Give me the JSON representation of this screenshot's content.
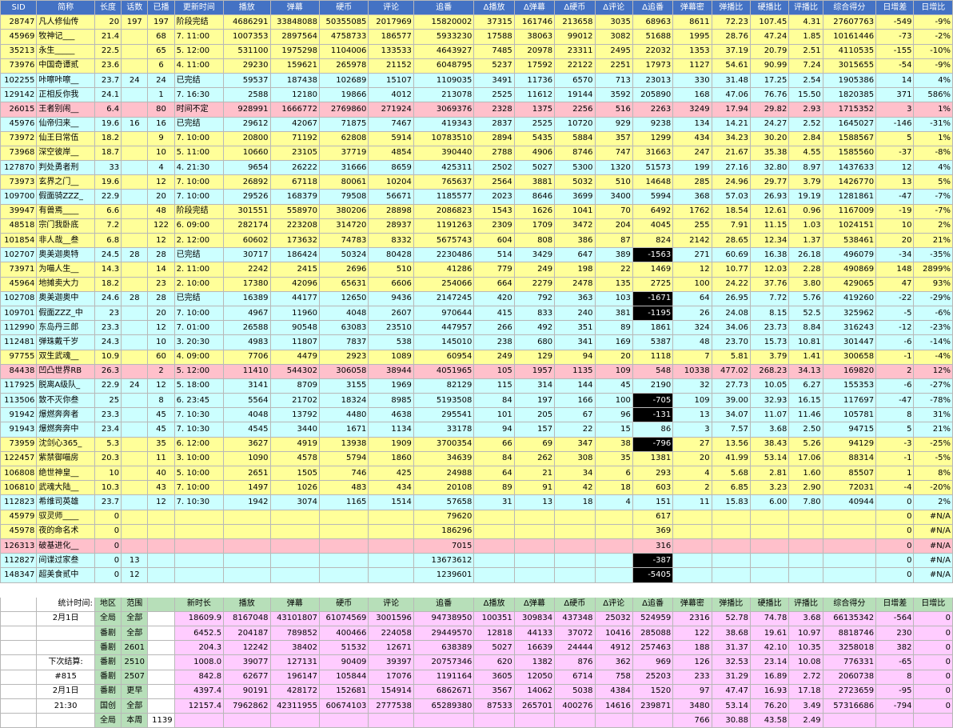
{
  "columns": [
    "SID",
    "简称",
    "长度",
    "话数",
    "已播",
    "更新时间",
    "播放",
    "弹幕",
    "硬币",
    "评论",
    "追番",
    "Δ播放",
    "Δ弹幕",
    "Δ硬币",
    "Δ评论",
    "Δ追番",
    "弹幕密",
    "弹播比",
    "硬播比",
    "评播比",
    "综合得分",
    "日增差",
    "日增比"
  ],
  "rows": [
    {
      "t": "y",
      "v": [
        "28747",
        "凡人修仙传",
        "20",
        "197",
        "197",
        "阶段完结",
        "4686291",
        "33848088",
        "50355085",
        "2017969",
        "15820002",
        "37315",
        "161746",
        "213658",
        "3035",
        "68963",
        "8611",
        "72.23",
        "107.45",
        "4.31",
        "27607763",
        "-549",
        "-9%"
      ]
    },
    {
      "t": "y",
      "v": [
        "45969",
        "牧神记___",
        "21.4",
        "",
        "68",
        "7. 11:00",
        "1007353",
        "2897564",
        "4758733",
        "186577",
        "5933230",
        "17588",
        "38063",
        "99012",
        "3082",
        "51688",
        "1995",
        "28.76",
        "47.24",
        "1.85",
        "10161446",
        "-73",
        "-2%"
      ]
    },
    {
      "t": "y",
      "v": [
        "35213",
        "永生_____",
        "22.5",
        "",
        "65",
        "5. 12:00",
        "531100",
        "1975298",
        "1104006",
        "133533",
        "4643927",
        "7485",
        "20978",
        "23311",
        "2495",
        "22032",
        "1353",
        "37.19",
        "20.79",
        "2.51",
        "4110535",
        "-155",
        "-10%"
      ]
    },
    {
      "t": "y",
      "v": [
        "73976",
        "中国奇谭贰",
        "23.6",
        "",
        "6",
        "4. 11:00",
        "29230",
        "159621",
        "265978",
        "21152",
        "6048795",
        "5237",
        "17592",
        "22122",
        "2251",
        "17973",
        "1127",
        "54.61",
        "90.99",
        "7.24",
        "3015655",
        "-54",
        "-9%"
      ]
    },
    {
      "t": "c",
      "v": [
        "102255",
        "咔嚓咔嚓__",
        "23.7",
        "24",
        "24",
        "已完结",
        "59537",
        "187438",
        "102689",
        "15107",
        "1109035",
        "3491",
        "11736",
        "6570",
        "713",
        "23013",
        "330",
        "31.48",
        "17.25",
        "2.54",
        "1905386",
        "14",
        "4%"
      ]
    },
    {
      "t": "c",
      "v": [
        "129142",
        "正相反你我",
        "24.1",
        "",
        "1",
        "7. 16:30",
        "2588",
        "12180",
        "19866",
        "4012",
        "213078",
        "2525",
        "11612",
        "19144",
        "3592",
        "205890",
        "168",
        "47.06",
        "76.76",
        "15.50",
        "1820385",
        "371",
        "586%"
      ]
    },
    {
      "t": "p",
      "v": [
        "26015",
        "王者别闹__",
        "6.4",
        "",
        "80",
        "时间不定",
        "928991",
        "1666772",
        "2769860",
        "271924",
        "3069376",
        "2328",
        "1375",
        "2256",
        "516",
        "2263",
        "3249",
        "17.94",
        "29.82",
        "2.93",
        "1715352",
        "3",
        "1%"
      ]
    },
    {
      "t": "c",
      "v": [
        "45976",
        "仙帝归来__",
        "19.6",
        "16",
        "16",
        "已完结",
        "29612",
        "42067",
        "71875",
        "7467",
        "419343",
        "2837",
        "2525",
        "10720",
        "929",
        "9238",
        "134",
        "14.21",
        "24.27",
        "2.52",
        "1645027",
        "-146",
        "-31%"
      ]
    },
    {
      "t": "y",
      "v": [
        "73972",
        "仙王日常伍",
        "18.2",
        "",
        "9",
        "7. 10:00",
        "20800",
        "71192",
        "62808",
        "5914",
        "10783510",
        "2894",
        "5435",
        "5884",
        "357",
        "1299",
        "434",
        "34.23",
        "30.20",
        "2.84",
        "1588567",
        "5",
        "1%"
      ]
    },
    {
      "t": "y",
      "v": [
        "73968",
        "深空彼岸__",
        "18.7",
        "",
        "10",
        "5. 11:00",
        "10660",
        "23105",
        "37719",
        "4854",
        "390440",
        "2788",
        "4906",
        "8746",
        "747",
        "31663",
        "247",
        "21.67",
        "35.38",
        "4.55",
        "1585560",
        "-37",
        "-8%"
      ]
    },
    {
      "t": "c",
      "v": [
        "127870",
        "判处勇者刑",
        "33",
        "",
        "4",
        "4. 21:30",
        "9654",
        "26222",
        "31666",
        "8659",
        "425311",
        "2502",
        "5027",
        "5300",
        "1320",
        "51573",
        "199",
        "27.16",
        "32.80",
        "8.97",
        "1437633",
        "12",
        "4%"
      ]
    },
    {
      "t": "y",
      "v": [
        "73973",
        "玄界之门__",
        "19.6",
        "",
        "12",
        "7. 10:00",
        "26892",
        "67118",
        "80061",
        "10204",
        "765637",
        "2564",
        "3881",
        "5032",
        "510",
        "14648",
        "285",
        "24.96",
        "29.77",
        "3.79",
        "1426770",
        "13",
        "5%"
      ]
    },
    {
      "t": "c",
      "v": [
        "109700",
        "假面骑ZZZ_",
        "22.9",
        "",
        "20",
        "7. 10:00",
        "29526",
        "168379",
        "79508",
        "56671",
        "1185577",
        "2023",
        "8646",
        "3699",
        "3400",
        "5994",
        "368",
        "57.03",
        "26.93",
        "19.19",
        "1281861",
        "-47",
        "-7%"
      ]
    },
    {
      "t": "y",
      "v": [
        "39947",
        "有兽焉____",
        "6.6",
        "",
        "48",
        "阶段完结",
        "301551",
        "558970",
        "380206",
        "28898",
        "2086823",
        "1543",
        "1626",
        "1041",
        "70",
        "6492",
        "1762",
        "18.54",
        "12.61",
        "0.96",
        "1167009",
        "-19",
        "-7%"
      ]
    },
    {
      "t": "y",
      "v": [
        "48518",
        "宗门我卧底",
        "7.2",
        "",
        "122",
        "6. 09:00",
        "282174",
        "223208",
        "314720",
        "28937",
        "1191263",
        "2309",
        "1709",
        "3472",
        "204",
        "4045",
        "255",
        "7.91",
        "11.15",
        "1.03",
        "1024151",
        "10",
        "2%"
      ]
    },
    {
      "t": "y",
      "v": [
        "101854",
        "非人哉__叁",
        "6.8",
        "",
        "12",
        "2. 12:00",
        "60602",
        "173632",
        "74783",
        "8332",
        "5675743",
        "604",
        "808",
        "386",
        "87",
        "824",
        "2142",
        "28.65",
        "12.34",
        "1.37",
        "538461",
        "20",
        "21%"
      ]
    },
    {
      "t": "c",
      "v": [
        "102707",
        "奥美迦奥特",
        "24.5",
        "28",
        "28",
        "已完结",
        "30717",
        "186424",
        "50324",
        "80428",
        "2230486",
        "514",
        "3429",
        "647",
        "389",
        "-1563",
        "271",
        "60.69",
        "16.38",
        "26.18",
        "496079",
        "-34",
        "-35%"
      ]
    },
    {
      "t": "y",
      "v": [
        "73971",
        "为喵人生__",
        "14.3",
        "",
        "14",
        "2. 11:00",
        "2242",
        "2415",
        "2696",
        "510",
        "41286",
        "779",
        "249",
        "198",
        "22",
        "1469",
        "12",
        "10.77",
        "12.03",
        "2.28",
        "490869",
        "148",
        "2899%"
      ]
    },
    {
      "t": "y",
      "v": [
        "45964",
        "地摊卖大力",
        "18.2",
        "",
        "23",
        "2. 10:00",
        "17380",
        "42096",
        "65631",
        "6606",
        "254066",
        "664",
        "2279",
        "2478",
        "135",
        "2725",
        "100",
        "24.22",
        "37.76",
        "3.80",
        "429065",
        "47",
        "93%"
      ]
    },
    {
      "t": "c",
      "v": [
        "102708",
        "奥美迦奥中",
        "24.6",
        "28",
        "28",
        "已完结",
        "16389",
        "44177",
        "12650",
        "9436",
        "2147245",
        "420",
        "792",
        "363",
        "103",
        "-1671",
        "64",
        "26.95",
        "7.72",
        "5.76",
        "419260",
        "-22",
        "-29%"
      ]
    },
    {
      "t": "c",
      "v": [
        "109701",
        "假面ZZZ_中",
        "23",
        "",
        "20",
        "7. 10:00",
        "4967",
        "11960",
        "4048",
        "2607",
        "970644",
        "415",
        "833",
        "240",
        "381",
        "-1195",
        "26",
        "24.08",
        "8.15",
        "52.5",
        "325962",
        "-5",
        "-6%"
      ]
    },
    {
      "t": "c",
      "v": [
        "112990",
        "东岛丹三郎",
        "23.3",
        "",
        "12",
        "7. 01:00",
        "26588",
        "90548",
        "63083",
        "23510",
        "447957",
        "266",
        "492",
        "351",
        "89",
        "1861",
        "324",
        "34.06",
        "23.73",
        "8.84",
        "316243",
        "-12",
        "-23%"
      ]
    },
    {
      "t": "c",
      "v": [
        "112481",
        "弹珠戴千岁",
        "24.3",
        "",
        "10",
        "3. 20:30",
        "4983",
        "11807",
        "7837",
        "538",
        "145010",
        "238",
        "680",
        "341",
        "169",
        "5387",
        "48",
        "23.70",
        "15.73",
        "10.81",
        "301447",
        "-6",
        "-14%"
      ]
    },
    {
      "t": "y",
      "v": [
        "97755",
        "双生武魂__",
        "10.9",
        "",
        "60",
        "4. 09:00",
        "7706",
        "4479",
        "2923",
        "1089",
        "60954",
        "249",
        "129",
        "94",
        "20",
        "1118",
        "7",
        "5.81",
        "3.79",
        "1.41",
        "300658",
        "-1",
        "-4%"
      ]
    },
    {
      "t": "p",
      "v": [
        "84438",
        "凹凸世界RB",
        "26.3",
        "",
        "2",
        "5. 12:00",
        "11410",
        "544302",
        "306058",
        "38944",
        "4051965",
        "105",
        "1957",
        "1135",
        "109",
        "548",
        "10338",
        "477.02",
        "268.23",
        "34.13",
        "169820",
        "2",
        "12%"
      ]
    },
    {
      "t": "c",
      "v": [
        "117925",
        "脱离A级队_",
        "22.9",
        "24",
        "12",
        "5. 18:00",
        "3141",
        "8709",
        "3155",
        "1969",
        "82129",
        "115",
        "314",
        "144",
        "45",
        "2190",
        "32",
        "27.73",
        "10.05",
        "6.27",
        "155353",
        "-6",
        "-27%"
      ]
    },
    {
      "t": "c",
      "v": [
        "113506",
        "致不灭你叁",
        "25",
        "",
        "8",
        "6. 23:45",
        "5564",
        "21702",
        "18324",
        "8985",
        "5193508",
        "84",
        "197",
        "166",
        "100",
        "-705",
        "109",
        "39.00",
        "32.93",
        "16.15",
        "117697",
        "-47",
        "-78%"
      ]
    },
    {
      "t": "c",
      "v": [
        "91942",
        "爆燃奔奔者",
        "23.3",
        "",
        "45",
        "7. 10:30",
        "4048",
        "13792",
        "4480",
        "4638",
        "295541",
        "101",
        "205",
        "67",
        "96",
        "-131",
        "13",
        "34.07",
        "11.07",
        "11.46",
        "105781",
        "8",
        "31%"
      ]
    },
    {
      "t": "c",
      "v": [
        "91943",
        "爆燃奔奔中",
        "23.4",
        "",
        "45",
        "7. 10:30",
        "4545",
        "3440",
        "1671",
        "1134",
        "33178",
        "94",
        "157",
        "22",
        "15",
        "86",
        "3",
        "7.57",
        "3.68",
        "2.50",
        "94715",
        "5",
        "21%"
      ]
    },
    {
      "t": "y",
      "v": [
        "73959",
        "沈剑心365_",
        "5.3",
        "",
        "35",
        "6. 12:00",
        "3627",
        "4919",
        "13938",
        "1909",
        "3700354",
        "66",
        "69",
        "347",
        "38",
        "-796",
        "27",
        "13.56",
        "38.43",
        "5.26",
        "94129",
        "-3",
        "-25%"
      ]
    },
    {
      "t": "y",
      "v": [
        "122457",
        "紫禁御喵房",
        "20.3",
        "",
        "11",
        "3. 10:00",
        "1090",
        "4578",
        "5794",
        "1860",
        "34639",
        "84",
        "262",
        "308",
        "35",
        "1381",
        "20",
        "41.99",
        "53.14",
        "17.06",
        "88314",
        "-1",
        "-5%"
      ]
    },
    {
      "t": "y",
      "v": [
        "106808",
        "绝世神皇__",
        "10",
        "",
        "40",
        "5. 10:00",
        "2651",
        "1505",
        "746",
        "425",
        "24988",
        "64",
        "21",
        "34",
        "6",
        "293",
        "4",
        "5.68",
        "2.81",
        "1.60",
        "85507",
        "1",
        "8%"
      ]
    },
    {
      "t": "y",
      "v": [
        "106810",
        "武魂大陆__",
        "10.3",
        "",
        "43",
        "7. 10:00",
        "1497",
        "1026",
        "483",
        "434",
        "20108",
        "89",
        "91",
        "42",
        "18",
        "603",
        "2",
        "6.85",
        "3.23",
        "2.90",
        "72031",
        "-4",
        "-20%"
      ]
    },
    {
      "t": "c",
      "v": [
        "112823",
        "希维司英雄",
        "23.7",
        "",
        "12",
        "7. 10:30",
        "1942",
        "3074",
        "1165",
        "1514",
        "57658",
        "31",
        "13",
        "18",
        "4",
        "151",
        "11",
        "15.83",
        "6.00",
        "7.80",
        "40944",
        "0",
        "2%"
      ]
    },
    {
      "t": "y",
      "v": [
        "45979",
        "驭灵师____",
        "0",
        "",
        "",
        "",
        "",
        "",
        "",
        "",
        "79620",
        "",
        "",
        "",
        "",
        "617",
        "",
        "",
        "",
        "",
        "",
        "0",
        "#N/A"
      ]
    },
    {
      "t": "y",
      "v": [
        "45978",
        "夜的命名术",
        "0",
        "",
        "",
        "",
        "",
        "",
        "",
        "",
        "186296",
        "",
        "",
        "",
        "",
        "369",
        "",
        "",
        "",
        "",
        "",
        "0",
        "#N/A"
      ]
    },
    {
      "t": "p",
      "v": [
        "126313",
        "破基进化__",
        "0",
        "",
        "",
        "",
        "",
        "",
        "",
        "",
        "7015",
        "",
        "",
        "",
        "",
        "316",
        "",
        "",
        "",
        "",
        "",
        "0",
        "#N/A"
      ]
    },
    {
      "t": "c",
      "v": [
        "112827",
        "间谍过家叁",
        "0",
        "13",
        "",
        "",
        "",
        "",
        "",
        "",
        "13673612",
        "",
        "",
        "",
        "",
        "-387",
        "",
        "",
        "",
        "",
        "",
        "0",
        "#N/A"
      ]
    },
    {
      "t": "c",
      "v": [
        "148347",
        "超美食贰中",
        "0",
        "12",
        "",
        "",
        "",
        "",
        "",
        "",
        "1239601",
        "",
        "",
        "",
        "",
        "-5405",
        "",
        "",
        "",
        "",
        "",
        "0",
        "#N/A"
      ]
    }
  ],
  "summary": {
    "columns": [
      "统计时间:",
      "地区",
      "范围",
      "",
      "新时长",
      "播放",
      "弹幕",
      "硬币",
      "评论",
      "追番",
      "Δ播放",
      "Δ弹幕",
      "Δ硬币",
      "Δ评论",
      "Δ追番",
      "弹幕密",
      "弹播比",
      "硬播比",
      "评播比",
      "综合得分",
      "日增差",
      "日增比"
    ],
    "rows": [
      [
        "2月1日",
        "全局",
        "全部",
        "",
        "18609.9",
        "8167048",
        "43101807",
        "61074569",
        "3001596",
        "94738950",
        "100351",
        "309834",
        "437348",
        "25032",
        "524959",
        "2316",
        "52.78",
        "74.78",
        "3.68",
        "66135342",
        "-564",
        "0"
      ],
      [
        "",
        "番剧",
        "全部",
        "",
        "6452.5",
        "204187",
        "789852",
        "400466",
        "224058",
        "29449570",
        "12818",
        "44133",
        "37072",
        "10416",
        "285088",
        "122",
        "38.68",
        "19.61",
        "10.97",
        "8818746",
        "230",
        "0"
      ],
      [
        "",
        "番剧",
        "2601",
        "",
        "204.3",
        "12242",
        "38402",
        "51532",
        "12671",
        "638389",
        "5027",
        "16639",
        "24444",
        "4912",
        "257463",
        "188",
        "31.37",
        "42.10",
        "10.35",
        "3258018",
        "382",
        "0"
      ],
      [
        "下次结算:",
        "番剧",
        "2510",
        "",
        "1008.0",
        "39077",
        "127131",
        "90409",
        "39397",
        "20757346",
        "620",
        "1382",
        "876",
        "362",
        "969",
        "126",
        "32.53",
        "23.14",
        "10.08",
        "776331",
        "-65",
        "0"
      ],
      [
        "#815",
        "番剧",
        "2507",
        "",
        "842.8",
        "62677",
        "196147",
        "105844",
        "17076",
        "1191164",
        "3605",
        "12050",
        "6714",
        "758",
        "25203",
        "233",
        "31.29",
        "16.89",
        "2.72",
        "2060738",
        "8",
        "0"
      ],
      [
        "2月1日",
        "番剧",
        "更早",
        "",
        "4397.4",
        "90191",
        "428172",
        "152681",
        "154914",
        "6862671",
        "3567",
        "14062",
        "5038",
        "4384",
        "1520",
        "97",
        "47.47",
        "16.93",
        "17.18",
        "2723659",
        "-95",
        "0"
      ],
      [
        "21:30",
        "国创",
        "全部",
        "",
        "12157.4",
        "7962862",
        "42311955",
        "60674103",
        "2777538",
        "65289380",
        "87533",
        "265701",
        "400276",
        "14616",
        "239871",
        "3480",
        "53.14",
        "76.20",
        "3.49",
        "57316686",
        "-794",
        "0"
      ],
      [
        "",
        "全局",
        "本周",
        "1139",
        "",
        "",
        "",
        "",
        "",
        "",
        "",
        "",
        "",
        "",
        "",
        "766",
        "30.88",
        "43.58",
        "2.49",
        "",
        "",
        ""
      ]
    ]
  }
}
